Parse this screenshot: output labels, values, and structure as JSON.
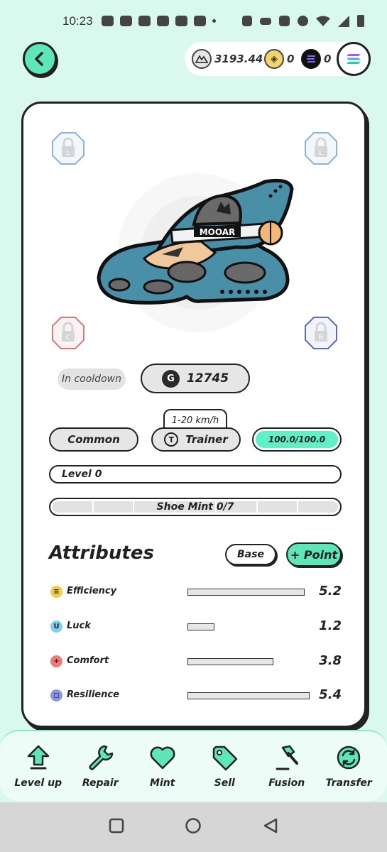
{
  "status_bar": {
    "time": "10:23"
  },
  "header": {
    "balances": [
      {
        "name": "gmt",
        "value": "3193.44",
        "icon": "gmt-coin-icon"
      },
      {
        "name": "ggt",
        "value": "0",
        "icon": "g-coin-icon"
      },
      {
        "name": "sol",
        "value": "0",
        "icon": "solana-coin-icon"
      }
    ]
  },
  "card": {
    "gem_slots": {
      "top_left": "L",
      "top_right": "L",
      "bottom_left": "C",
      "bottom_right": "R"
    },
    "shoe_logo": "MOOAR",
    "cooldown_label": "In cooldown",
    "price": {
      "currency_glyph": "G",
      "value": "12745"
    },
    "speed_range": "1-20 km/h",
    "rarity": "Common",
    "type": {
      "glyph": "T",
      "label": "Trainer"
    },
    "durability": {
      "text": "100.0/100.0",
      "fraction": 1.0
    },
    "level_label": "Level 0",
    "mint": {
      "label": "Shoe Mint 0/7",
      "segments": 7,
      "filled": 0
    },
    "attributes_title": "Attributes",
    "base_button": "Base",
    "point_button": "+ Point",
    "attributes": [
      {
        "name": "Efficiency",
        "value": "5.2",
        "glyph": "≡",
        "color": "#f3c94a"
      },
      {
        "name": "Luck",
        "value": "1.2",
        "glyph": "U",
        "color": "#7fd0f0"
      },
      {
        "name": "Comfort",
        "value": "3.8",
        "glyph": "+",
        "color": "#f07a7a"
      },
      {
        "name": "Resilience",
        "value": "5.4",
        "glyph": "◻",
        "color": "#8898e0"
      }
    ]
  },
  "bottom_nav": [
    {
      "label": "Level up",
      "icon": "arrow-up-icon"
    },
    {
      "label": "Repair",
      "icon": "wrench-icon"
    },
    {
      "label": "Mint",
      "icon": "heart-icon"
    },
    {
      "label": "Sell",
      "icon": "tag-icon"
    },
    {
      "label": "Fusion",
      "icon": "hammer-icon"
    },
    {
      "label": "Transfer",
      "icon": "transfer-icon"
    }
  ],
  "colors": {
    "accent": "#5ee5b8",
    "background": "#d9f8ee"
  }
}
